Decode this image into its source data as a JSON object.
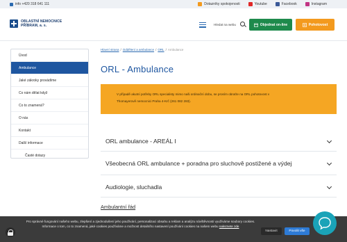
{
  "topbar": {
    "phone_label": "info +420 318 641 111",
    "links": [
      {
        "label": "Dotazníky spokojenosti",
        "icon": "survey-icon",
        "color": "#f39a1e"
      },
      {
        "label": "Youtube",
        "icon": "youtube-icon",
        "color": "#e02828"
      },
      {
        "label": "Facebook",
        "icon": "facebook-icon",
        "color": "#3b5998"
      },
      {
        "label": "Instagram",
        "icon": "instagram-icon",
        "color": "#c13584"
      }
    ]
  },
  "header": {
    "logo_line1": "OBLASTNÍ NEMOCNICE",
    "logo_line2": "PŘÍBRAM, a. s.",
    "search_label": "Hledat na webu",
    "book_button": "Objednat on-line",
    "emergency_button": "Pohotovost"
  },
  "sidebar": {
    "items": [
      {
        "label": "Úvod",
        "active": false
      },
      {
        "label": "Ambulance",
        "active": true
      },
      {
        "label": "Jaké zákroky provádíme",
        "active": false
      },
      {
        "label": "Co nám dělat když",
        "active": false
      },
      {
        "label": "Co to znamená?",
        "active": false
      },
      {
        "label": "O nás",
        "active": false
      },
      {
        "label": "Kontakt",
        "active": false
      },
      {
        "label": "Další informace",
        "active": false
      },
      {
        "label": "Časté dotazy",
        "active": false
      }
    ]
  },
  "breadcrumb": {
    "items": [
      "Hlavní strana",
      "Oddělení a ambulance",
      "ORL",
      "Ambulance"
    ]
  },
  "main": {
    "title": "ORL - Ambulance",
    "alert_line1": "V případě akutní potřeby ORL specialisty mimo naši ordinační dobu, se prosím obraťte na ORL pohotovost v",
    "alert_line2": "Thomayerově nemocnici Praha 4-Krč (261 082 283).",
    "accordion": [
      "ORL ambulance - AREÁL I",
      "Všeobecná ORL ambulance + poradna pro sluchově postižené a výdej",
      "Audiologie, sluchadla"
    ],
    "rules_link": "Ambulantní řád"
  },
  "cookie": {
    "text": "Pro správné fungování našeho webu, zlepšení a zjednodušení jeho používání, personalizaci obsahu a reklam a analýzu návštěvnosti využíváme soubory cookies. Informace o tom, co to znamená, jaké cookies používáme a možnost detailního nastavení používání cookies na našem webu",
    "more_link": "naleznete zde",
    "settings_button": "Nastavit",
    "accept_button": "Povolit vše"
  },
  "colors": {
    "primary_blue": "#1e56a0",
    "alert_orange": "#f5a623",
    "button_green": "#1e8a4c",
    "button_orange": "#f39a1e",
    "chat_teal": "#1aa3b8"
  }
}
